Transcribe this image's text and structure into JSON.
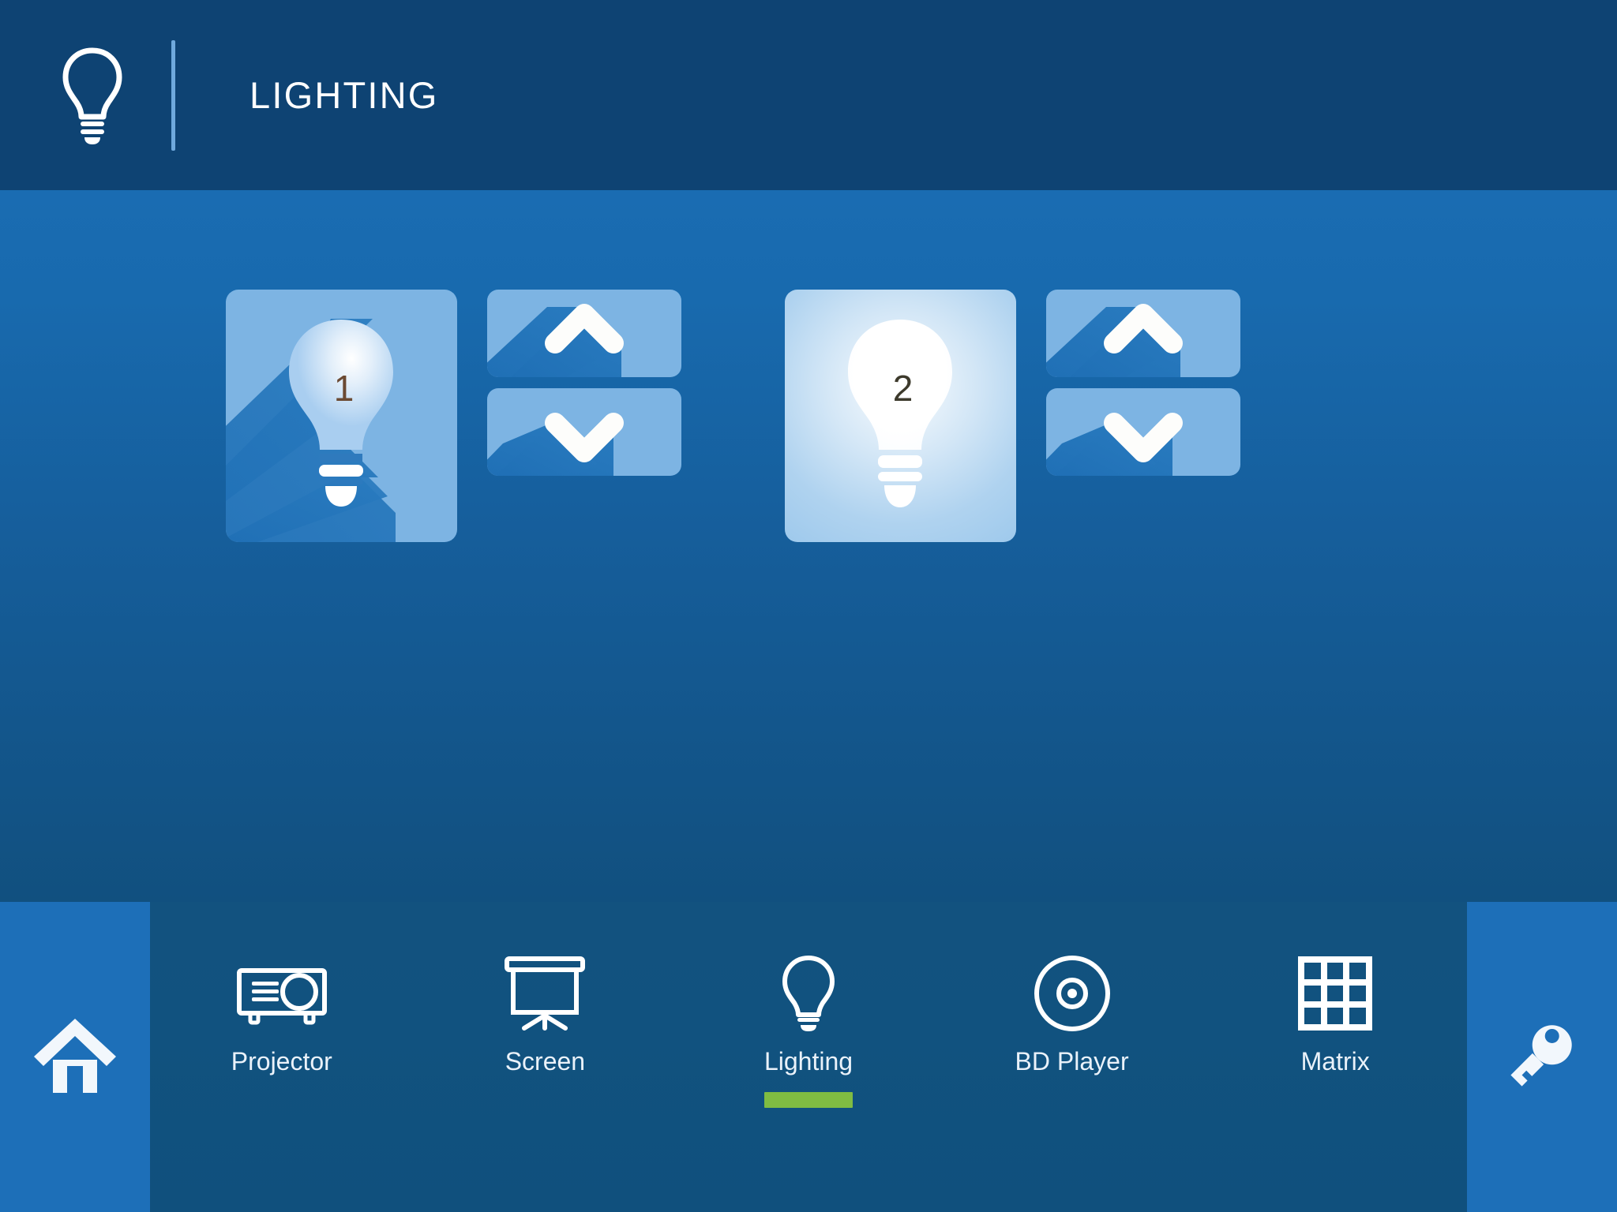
{
  "header": {
    "icon": "lightbulb-icon",
    "title": "LIGHTING",
    "divider": "vertical-divider",
    "background_color": "#0e4373",
    "text_color": "#ffffff"
  },
  "theme": {
    "body_gradient_top": "#1a6cb2",
    "body_gradient_bottom": "#11507f",
    "tile_color": "#7db4e3",
    "tile_on_color": "#9ec9ec",
    "tile_shadow_color": "#1f6fb5",
    "accent_green": "#7fbc42",
    "side_panel_color": "#1d6fb8"
  },
  "main": {
    "zones": [
      {
        "id": "lighting-zone-1",
        "bulb": {
          "name": "bulb-1",
          "number": "1",
          "state": "off",
          "icon": "lightbulb-icon",
          "number_color": "#6b4a33"
        },
        "up_button": {
          "name": "zone-1-brightness-up",
          "icon": "chevron-up-icon"
        },
        "down_button": {
          "name": "zone-1-brightness-down",
          "icon": "chevron-down-icon"
        }
      },
      {
        "id": "lighting-zone-2",
        "bulb": {
          "name": "bulb-2",
          "number": "2",
          "state": "on",
          "icon": "lightbulb-icon",
          "number_color": "#3d3a2c"
        },
        "up_button": {
          "name": "zone-2-brightness-up",
          "icon": "chevron-up-icon"
        },
        "down_button": {
          "name": "zone-2-brightness-down",
          "icon": "chevron-down-icon"
        }
      }
    ]
  },
  "navbar": {
    "home_button": {
      "label": "Home",
      "icon": "home-icon"
    },
    "key_button": {
      "label": "Key",
      "icon": "key-icon"
    },
    "items": [
      {
        "label": "Projector",
        "icon": "projector-icon",
        "active": false
      },
      {
        "label": "Screen",
        "icon": "projection-screen-icon",
        "active": false
      },
      {
        "label": "Lighting",
        "icon": "lightbulb-icon",
        "active": true
      },
      {
        "label": "BD Player",
        "icon": "disc-icon",
        "active": false
      },
      {
        "label": "Matrix",
        "icon": "grid-icon",
        "active": false
      }
    ]
  }
}
